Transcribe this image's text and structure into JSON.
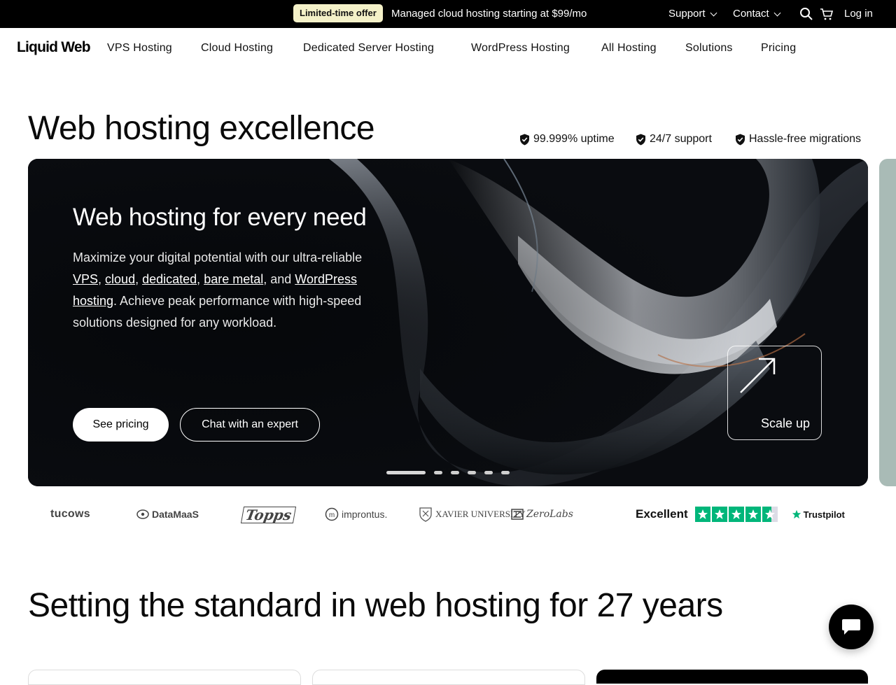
{
  "promo": {
    "badge": "Limited-time offer",
    "text": "Managed cloud hosting starting at $99/mo"
  },
  "utility": {
    "support": "Support",
    "contact": "Contact",
    "login": "Log in",
    "icons": [
      "search-icon",
      "cart-icon"
    ]
  },
  "brand": {
    "logo": "Liquid Web"
  },
  "nav": {
    "items": [
      "VPS Hosting",
      "Cloud Hosting",
      "Dedicated Server Hosting",
      "WordPress Hosting",
      "All Hosting",
      "Solutions",
      "Pricing"
    ]
  },
  "hero": {
    "title": "Web hosting excellence",
    "features": [
      "99.999% uptime",
      "24/7 support",
      "Hassle-free migrations"
    ]
  },
  "card": {
    "title": "Web hosting for every need",
    "desc_lead": "Maximize your digital potential with our ultra-reliable ",
    "links": [
      "VPS",
      "cloud",
      "dedicated",
      "bare metal",
      "WordPress hosting"
    ],
    "sep1": ", ",
    "sep2": ", ",
    "sep3": ", ",
    "sep4": ", and ",
    "desc_tail": ". Achieve peak performance with high-speed solutions designed for any workload.",
    "btn_primary": "See pricing",
    "btn_secondary": "Chat with an expert",
    "scale_label": "Scale up",
    "carousel": {
      "slides": 6,
      "active": 1
    }
  },
  "logos": {
    "items": [
      "tucows",
      "DataMaaS",
      "Topps",
      "improntus.",
      "XAVIER UNIVERSITY",
      "ZeroLabs"
    ],
    "trust_label": "Excellent",
    "trust_rating": 4.5,
    "trust_name": "Trustpilot",
    "colors": {
      "trustpilot_green": "#00b67a"
    }
  },
  "section": {
    "title": "Setting the standard in web hosting for 27 years"
  },
  "colors": {
    "promo_bg": "#000000",
    "badge_bg": "#f4f1c8",
    "hero_bg": "#07090d",
    "accent_sage": "#a9bbb6"
  }
}
